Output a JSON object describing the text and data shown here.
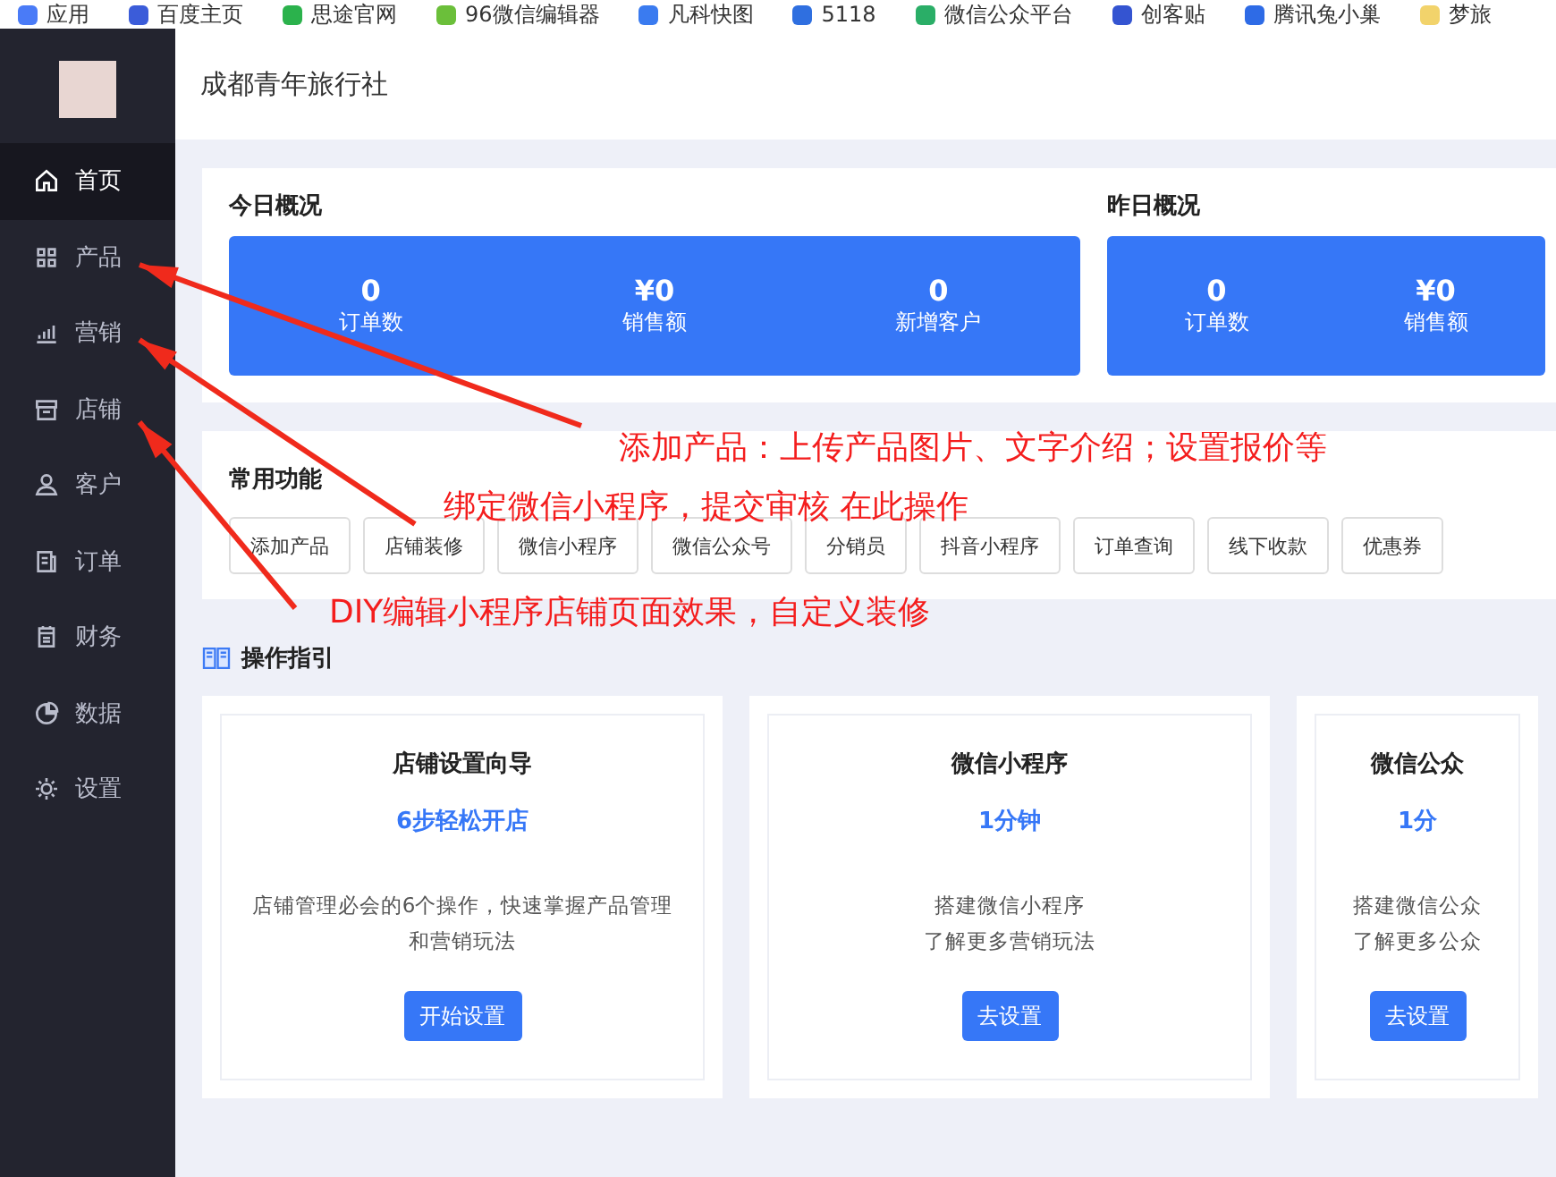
{
  "bookmarks": [
    {
      "label": "应用"
    },
    {
      "label": "百度主页"
    },
    {
      "label": "思途官网"
    },
    {
      "label": "96微信编辑器"
    },
    {
      "label": "凡科快图"
    },
    {
      "label": "5118"
    },
    {
      "label": "微信公众平台"
    },
    {
      "label": "创客贴"
    },
    {
      "label": "腾讯兔小巢"
    },
    {
      "label": "梦旅"
    }
  ],
  "sidebar": {
    "items": [
      {
        "label": "首页",
        "selected": true
      },
      {
        "label": "产品",
        "selected": false
      },
      {
        "label": "营销",
        "selected": false
      },
      {
        "label": "店铺",
        "selected": false
      },
      {
        "label": "客户",
        "selected": false
      },
      {
        "label": "订单",
        "selected": false
      },
      {
        "label": "财务",
        "selected": false
      },
      {
        "label": "数据",
        "selected": false
      },
      {
        "label": "设置",
        "selected": false
      }
    ]
  },
  "header": {
    "title": "成都青年旅行社"
  },
  "overview": [
    {
      "title": "今日概况",
      "stats": [
        {
          "value": "0",
          "label": "订单数"
        },
        {
          "value": "¥0",
          "label": "销售额"
        },
        {
          "value": "0",
          "label": "新增客户"
        }
      ]
    },
    {
      "title": "昨日概况",
      "stats": [
        {
          "value": "0",
          "label": "订单数"
        },
        {
          "value": "¥0",
          "label": "销售额"
        }
      ]
    }
  ],
  "quick_functions": {
    "title": "常用功能",
    "buttons": [
      "添加产品",
      "店铺装修",
      "微信小程序",
      "微信公众号",
      "分销员",
      "抖音小程序",
      "订单查询",
      "线下收款",
      "优惠券"
    ]
  },
  "guide": {
    "title": "操作指引",
    "cards": [
      {
        "title": "店铺设置向导",
        "highlight": "6步轻松开店",
        "description": [
          "店铺管理必会的6个操作，快速掌握产品管理",
          "和营销玩法"
        ],
        "button": "开始设置"
      },
      {
        "title": "微信小程序",
        "highlight": "1分钟",
        "description": [
          "搭建微信小程序",
          "了解更多营销玩法"
        ],
        "button": "去设置"
      },
      {
        "title": "微信公众",
        "highlight": "1分",
        "description": [
          "搭建微信公众",
          "了解更多公众"
        ],
        "button": "去设置"
      }
    ]
  },
  "annotations": [
    {
      "text": "添加产品：上传产品图片、文字介绍；设置报价等"
    },
    {
      "text": "绑定微信小程序，提交审核 在此操作"
    },
    {
      "text": "DIY编辑小程序店铺页面效果，自定义装修"
    }
  ]
}
